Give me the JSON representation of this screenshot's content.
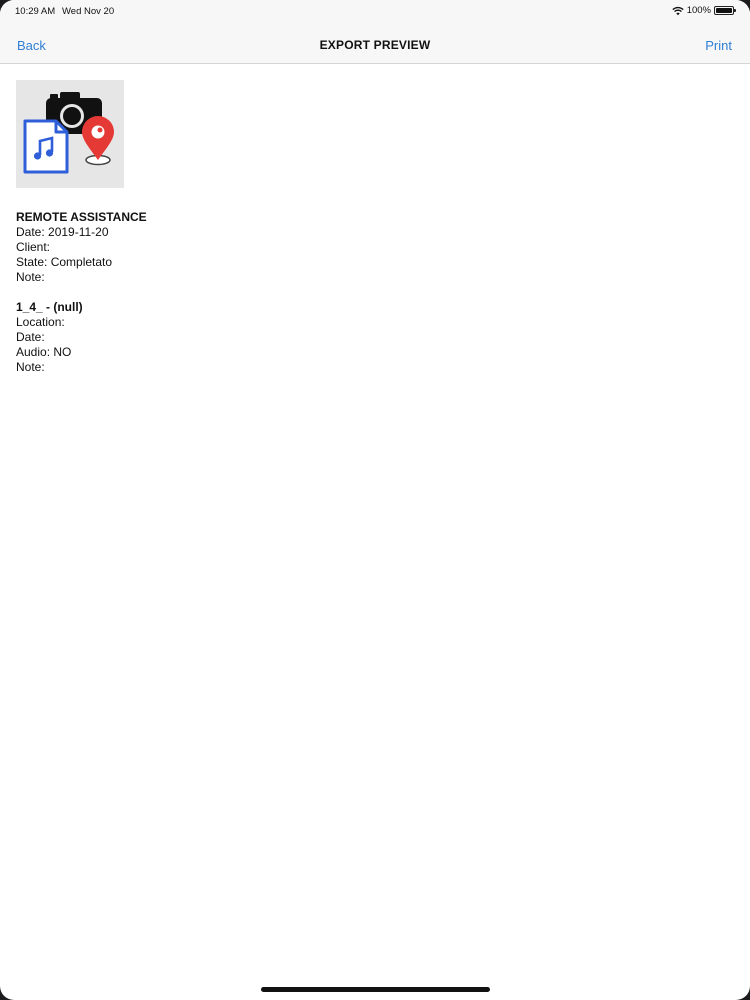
{
  "status_bar": {
    "time": "10:29 AM",
    "date": "Wed Nov 20",
    "battery": "100%",
    "icons": [
      "wifi-icon",
      "battery-icon"
    ]
  },
  "nav": {
    "back_label": "Back",
    "title": "EXPORT PREVIEW",
    "print_label": "Print",
    "accent_color": "#2f7fd6"
  },
  "thumbnail": {
    "icons": [
      "camera-icon",
      "music-file-icon",
      "location-pin-icon"
    ]
  },
  "report": {
    "heading": "REMOTE ASSISTANCE",
    "date_line": "Date: 2019-11-20",
    "client_line": "Client:",
    "state_line": "State: Completato",
    "note_line": "Note:"
  },
  "item": {
    "heading": "1_4_ - (null)",
    "location_line": "Location:",
    "date_line": "Date:",
    "audio_line": "Audio: NO",
    "note_line": "Note:"
  }
}
